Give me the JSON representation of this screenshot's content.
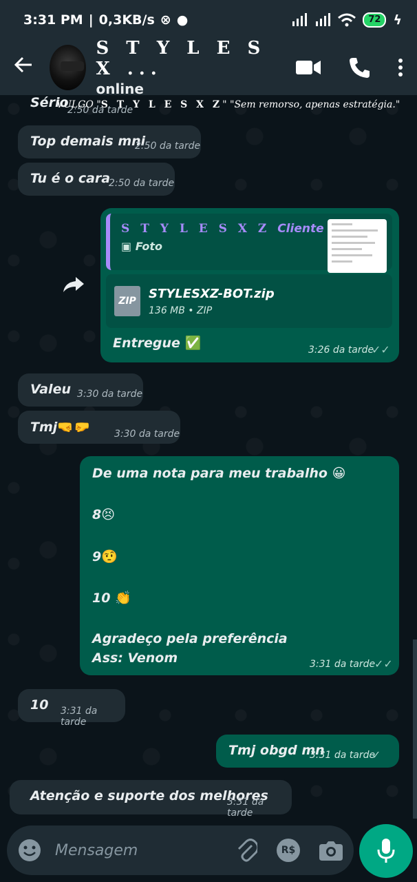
{
  "status_bar": {
    "time": "3:31 PM",
    "speed": "0,3KB/s",
    "battery": "72"
  },
  "header": {
    "name": "S T Y L E S X ...",
    "status": "online"
  },
  "top_overlay": {
    "partial_message": "Sério",
    "partial_time": "2:50 da tarde",
    "vulgo_prefix": "VULGO \"",
    "vulgo_name": "S T Y L E S X Z",
    "vulgo_suffix": "\" \"Sem remorso, apenas estratégia.\""
  },
  "messages": {
    "m1": {
      "text": "Top demais mni",
      "time": "2:50 da tarde"
    },
    "m2": {
      "text": "Tu é o cara",
      "time": "2:50 da tarde"
    },
    "file_msg": {
      "quote_name": "S T Y L E S X Z",
      "quote_role": "Cliente",
      "quote_sub": "Foto",
      "file_icon": "ZIP",
      "file_name": "STYLESXZ-BOT.zip",
      "file_meta": "136 MB • ZIP",
      "caption": "Entregue",
      "caption_emoji": "✅",
      "time": "3:26 da tarde",
      "ticks": "✓✓"
    },
    "m3": {
      "text": "Valeu",
      "time": "3:30 da tarde"
    },
    "m4": {
      "text": "Tmj",
      "emoji": "🤜🤛",
      "time": "3:30 da tarde"
    },
    "big": {
      "line1": "De uma nota para meu trabalho",
      "line1_emoji": "😀",
      "line2": "8",
      "line2_emoji": "😣",
      "line3": "9",
      "line3_emoji": "🤨",
      "line4": "10",
      "line4_emoji": "👏",
      "line5": "Agradeço pela preferência",
      "line6": "Ass: Venom",
      "time": "3:31 da tarde",
      "ticks": "✓✓"
    },
    "m5": {
      "text": "10",
      "time": "3:31 da tarde"
    },
    "m6": {
      "text": "Tmj obgd mn",
      "time": "3:31 da tarde",
      "ticks": "✓"
    },
    "m7": {
      "text": "Atenção e suporte dos melhores",
      "time": "3:31 da tarde"
    }
  },
  "composer": {
    "placeholder": "Mensagem",
    "currency": "R$"
  },
  "colors": {
    "header_bg": "#1f2c34",
    "incoming_bubble": "#202c33",
    "outgoing_bubble": "#005c4b",
    "accent": "#00a884"
  }
}
